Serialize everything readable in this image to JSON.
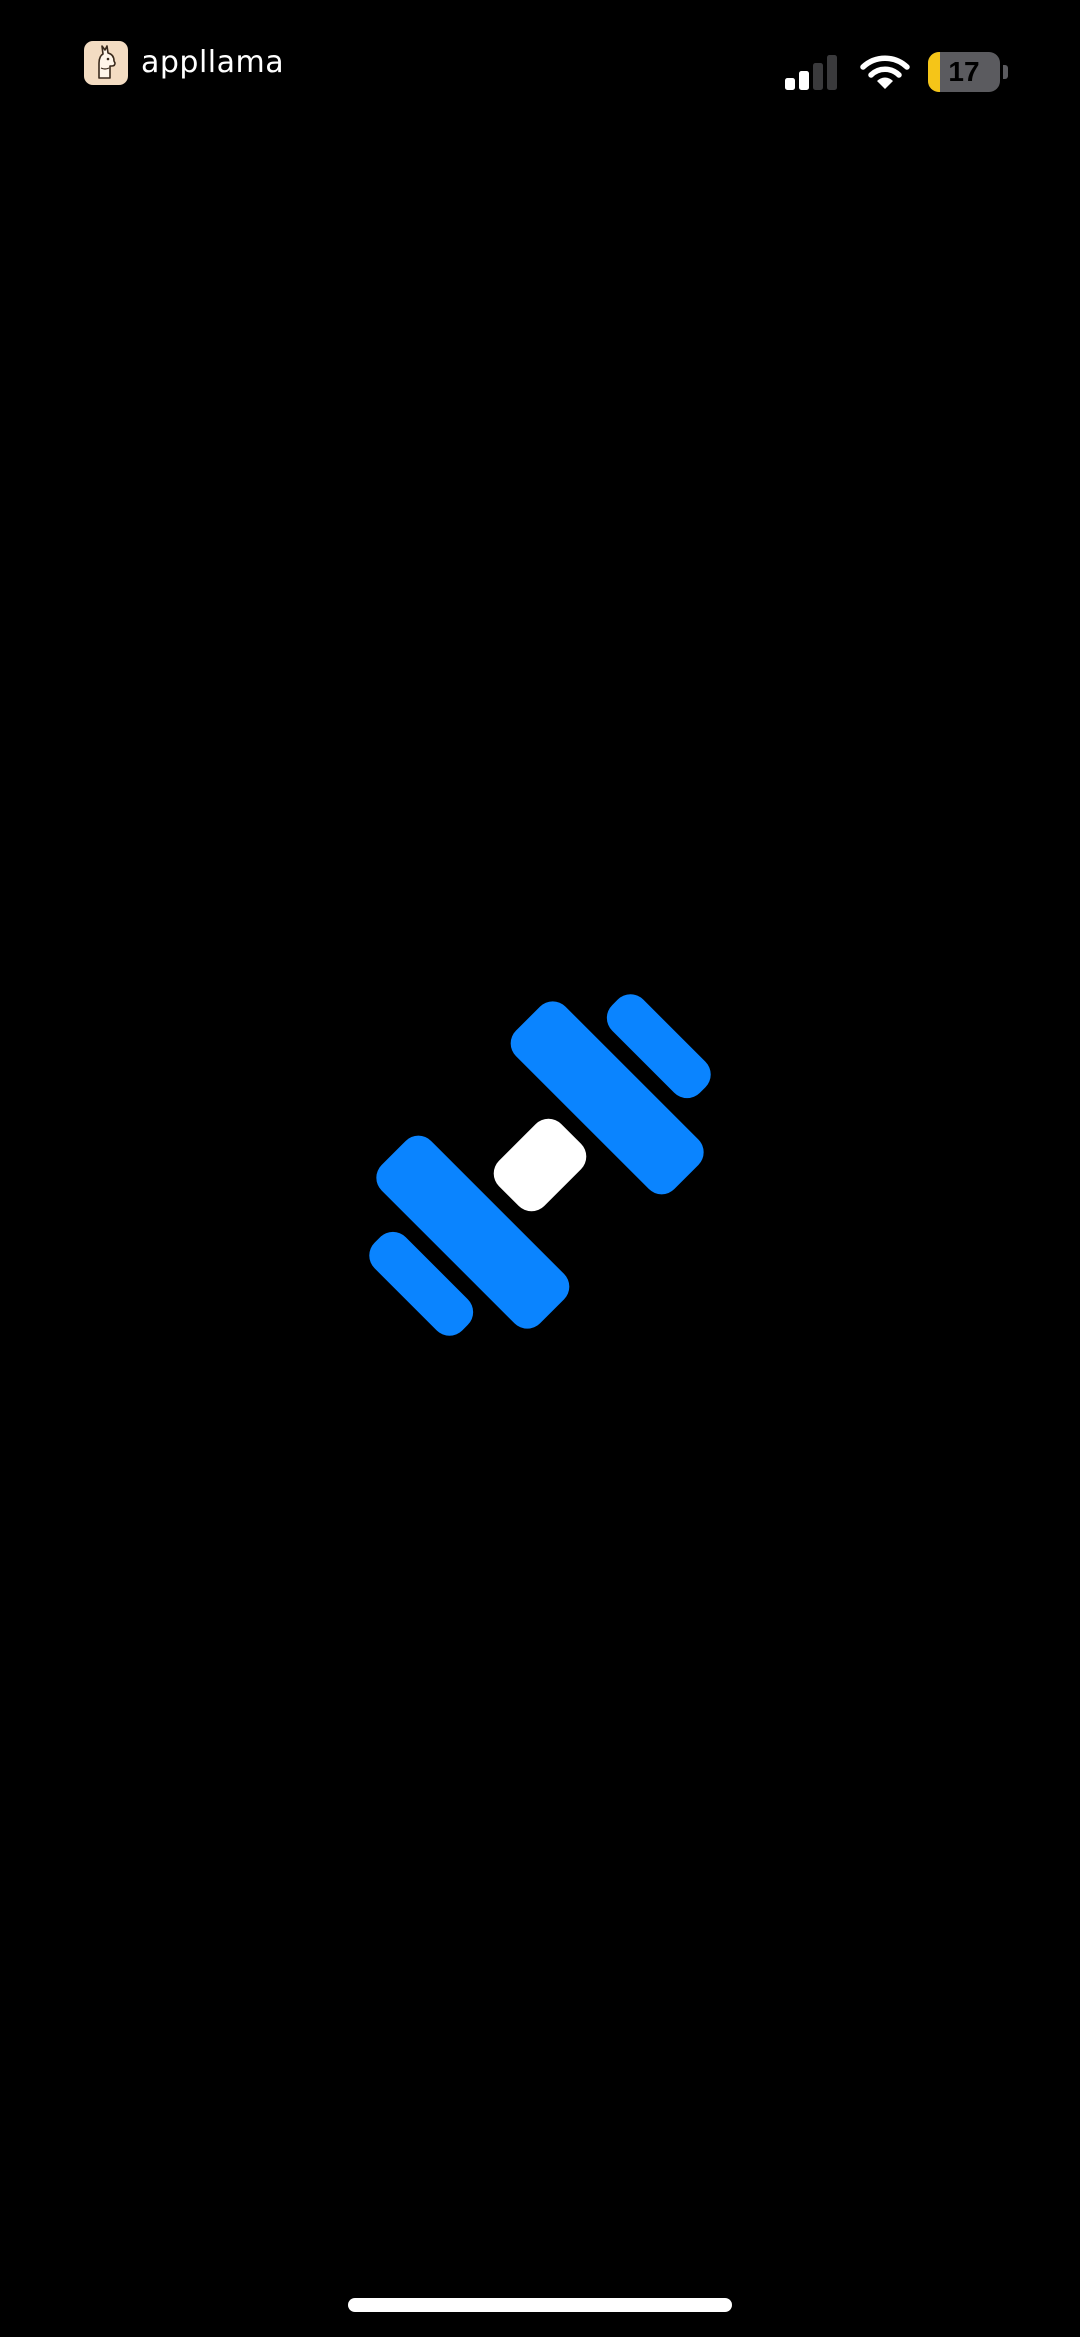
{
  "status_bar": {
    "app_name": "appllama",
    "signal_icon": "cellular-signal-icon",
    "signal_bars_active": 2,
    "signal_bars_total": 4,
    "wifi_icon": "wifi-icon",
    "battery_level": "17",
    "battery_percent": 17,
    "battery_color": "#f5c518"
  },
  "splash": {
    "logo_icon": "dumbbell-icon",
    "plate_color": "#0a84ff",
    "handle_color": "#ffffff"
  },
  "colors": {
    "background": "#000000",
    "accent": "#0a84ff"
  }
}
